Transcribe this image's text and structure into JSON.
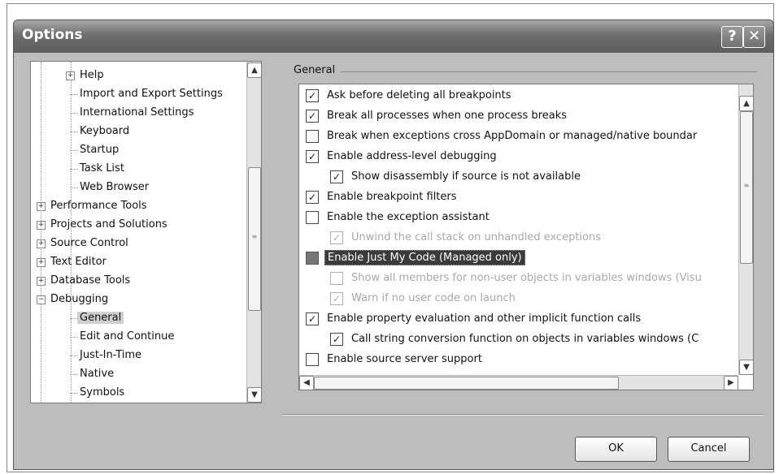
{
  "window": {
    "title": "Options"
  },
  "tree": {
    "items": [
      {
        "label": "Help",
        "level": 1,
        "expander": "+"
      },
      {
        "label": "Import and Export Settings",
        "level": 1
      },
      {
        "label": "International Settings",
        "level": 1
      },
      {
        "label": "Keyboard",
        "level": 1
      },
      {
        "label": "Startup",
        "level": 1
      },
      {
        "label": "Task List",
        "level": 1
      },
      {
        "label": "Web Browser",
        "level": 1
      },
      {
        "label": "Performance Tools",
        "level": 0,
        "expander": "+"
      },
      {
        "label": "Projects and Solutions",
        "level": 0,
        "expander": "+"
      },
      {
        "label": "Source Control",
        "level": 0,
        "expander": "+"
      },
      {
        "label": "Text Editor",
        "level": 0,
        "expander": "+"
      },
      {
        "label": "Database Tools",
        "level": 0,
        "expander": "+"
      },
      {
        "label": "Debugging",
        "level": 0,
        "expander": "−"
      },
      {
        "label": "General",
        "level": 1,
        "selected": true
      },
      {
        "label": "Edit and Continue",
        "level": 1
      },
      {
        "label": "Just-In-Time",
        "level": 1
      },
      {
        "label": "Native",
        "level": 1
      },
      {
        "label": "Symbols",
        "level": 1
      }
    ]
  },
  "group": {
    "title": "General"
  },
  "options": [
    {
      "label": "Ask before deleting all breakpoints",
      "checked": true,
      "level": 0
    },
    {
      "label": "Break all processes when one process breaks",
      "checked": true,
      "level": 0
    },
    {
      "label": "Break when exceptions cross AppDomain or managed/native boundar",
      "checked": false,
      "level": 0
    },
    {
      "label": "Enable address-level debugging",
      "checked": true,
      "level": 0
    },
    {
      "label": "Show disassembly if source is not available",
      "checked": true,
      "level": 1
    },
    {
      "label": "Enable breakpoint filters",
      "checked": true,
      "level": 0
    },
    {
      "label": "Enable the exception assistant",
      "checked": false,
      "level": 0
    },
    {
      "label": "Unwind the call stack on unhandled exceptions",
      "checked": true,
      "level": 1,
      "disabled": true
    },
    {
      "label": "Enable Just My Code (Managed only)",
      "checked": false,
      "level": 0,
      "highlighted": true
    },
    {
      "label": "Show all members for non-user objects in variables windows (Visu",
      "checked": false,
      "level": 1,
      "disabled": true
    },
    {
      "label": "Warn if no user code on launch",
      "checked": true,
      "level": 1,
      "disabled": true
    },
    {
      "label": "Enable property evaluation and other implicit function calls",
      "checked": true,
      "level": 0
    },
    {
      "label": "Call string conversion function on objects in variables windows (C",
      "checked": true,
      "level": 1
    },
    {
      "label": "Enable source server support",
      "checked": false,
      "level": 0
    }
  ],
  "buttons": {
    "ok": "OK",
    "cancel": "Cancel"
  },
  "icons": {
    "help": "?",
    "close": "✕",
    "up": "▲",
    "down": "▼",
    "left": "◀",
    "right": "▶",
    "check": "✓"
  },
  "colors": {
    "title_bar": "#6e6e6e",
    "dialog_bg": "#bdbdbd",
    "highlight": "#3a3a3a"
  }
}
